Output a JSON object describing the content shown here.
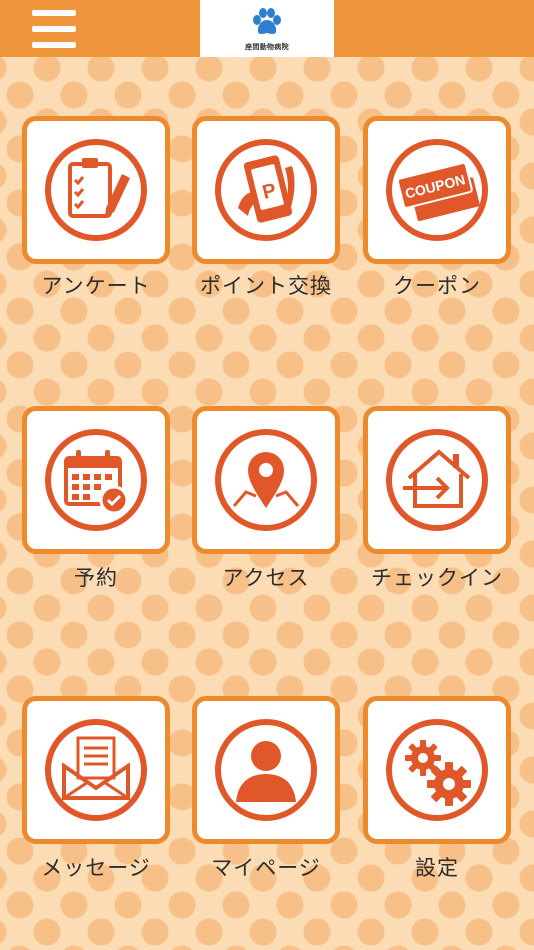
{
  "header": {
    "menu_icon": "hamburger-menu-icon",
    "logo_icon": "paw-icon",
    "logo_text": "座間動物病院",
    "bar_color": "#f0963d"
  },
  "menu": {
    "accent_color": "#e0582a",
    "items": [
      {
        "label": "アンケート",
        "icon": "survey-clipboard-icon"
      },
      {
        "label": "ポイント交換",
        "icon": "point-exchange-phone-icon"
      },
      {
        "label": "クーポン",
        "icon": "coupon-ticket-icon"
      },
      {
        "label": "予約",
        "icon": "calendar-check-icon"
      },
      {
        "label": "アクセス",
        "icon": "map-pin-icon"
      },
      {
        "label": "チェックイン",
        "icon": "house-arrow-icon"
      },
      {
        "label": "メッセージ",
        "icon": "envelope-letter-icon"
      },
      {
        "label": "マイページ",
        "icon": "user-person-icon"
      },
      {
        "label": "設定",
        "icon": "gears-icon"
      }
    ],
    "coupon_badge_text": "COUPON",
    "point_badge_text": "P"
  }
}
